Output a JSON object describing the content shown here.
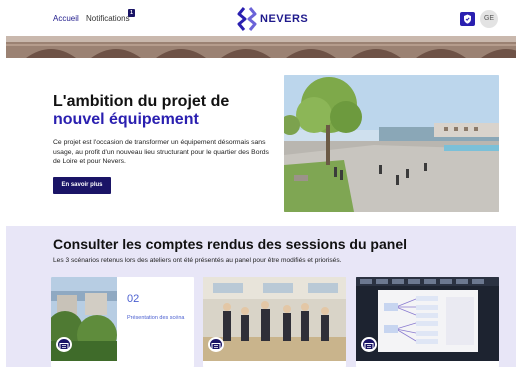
{
  "header": {
    "nav_home": "Accueil",
    "nav_notifications": "Notifications",
    "notification_count": "1",
    "logo_text": "NEVERS",
    "avatar_initials": "GE"
  },
  "hero": {
    "title_start": "L'ambition du projet de ",
    "title_accent": "nouvel équipement",
    "description": "Ce projet est l'occasion de transformer un équipement désormais sans usage, au profit d'un nouveau lieu structurant pour le quartier des Bords de Loire et pour Nevers.",
    "cta_label": "En savoir plus"
  },
  "panel": {
    "title": "Consulter les comptes rendus des sessions du panel",
    "subtitle": "Les 3 scénarios retenus lors des ateliers ont été présentés au panel pour être modifiés et priorisés.",
    "cards": [
      {
        "number": "02",
        "caption": "Présentation des scéna"
      },
      {
        "number": "",
        "caption": ""
      },
      {
        "number": "",
        "caption": ""
      }
    ]
  },
  "colors": {
    "brand_dark": "#1a1466",
    "brand_accent": "#2a1fb0",
    "panel_background": "#e8e6f7"
  }
}
